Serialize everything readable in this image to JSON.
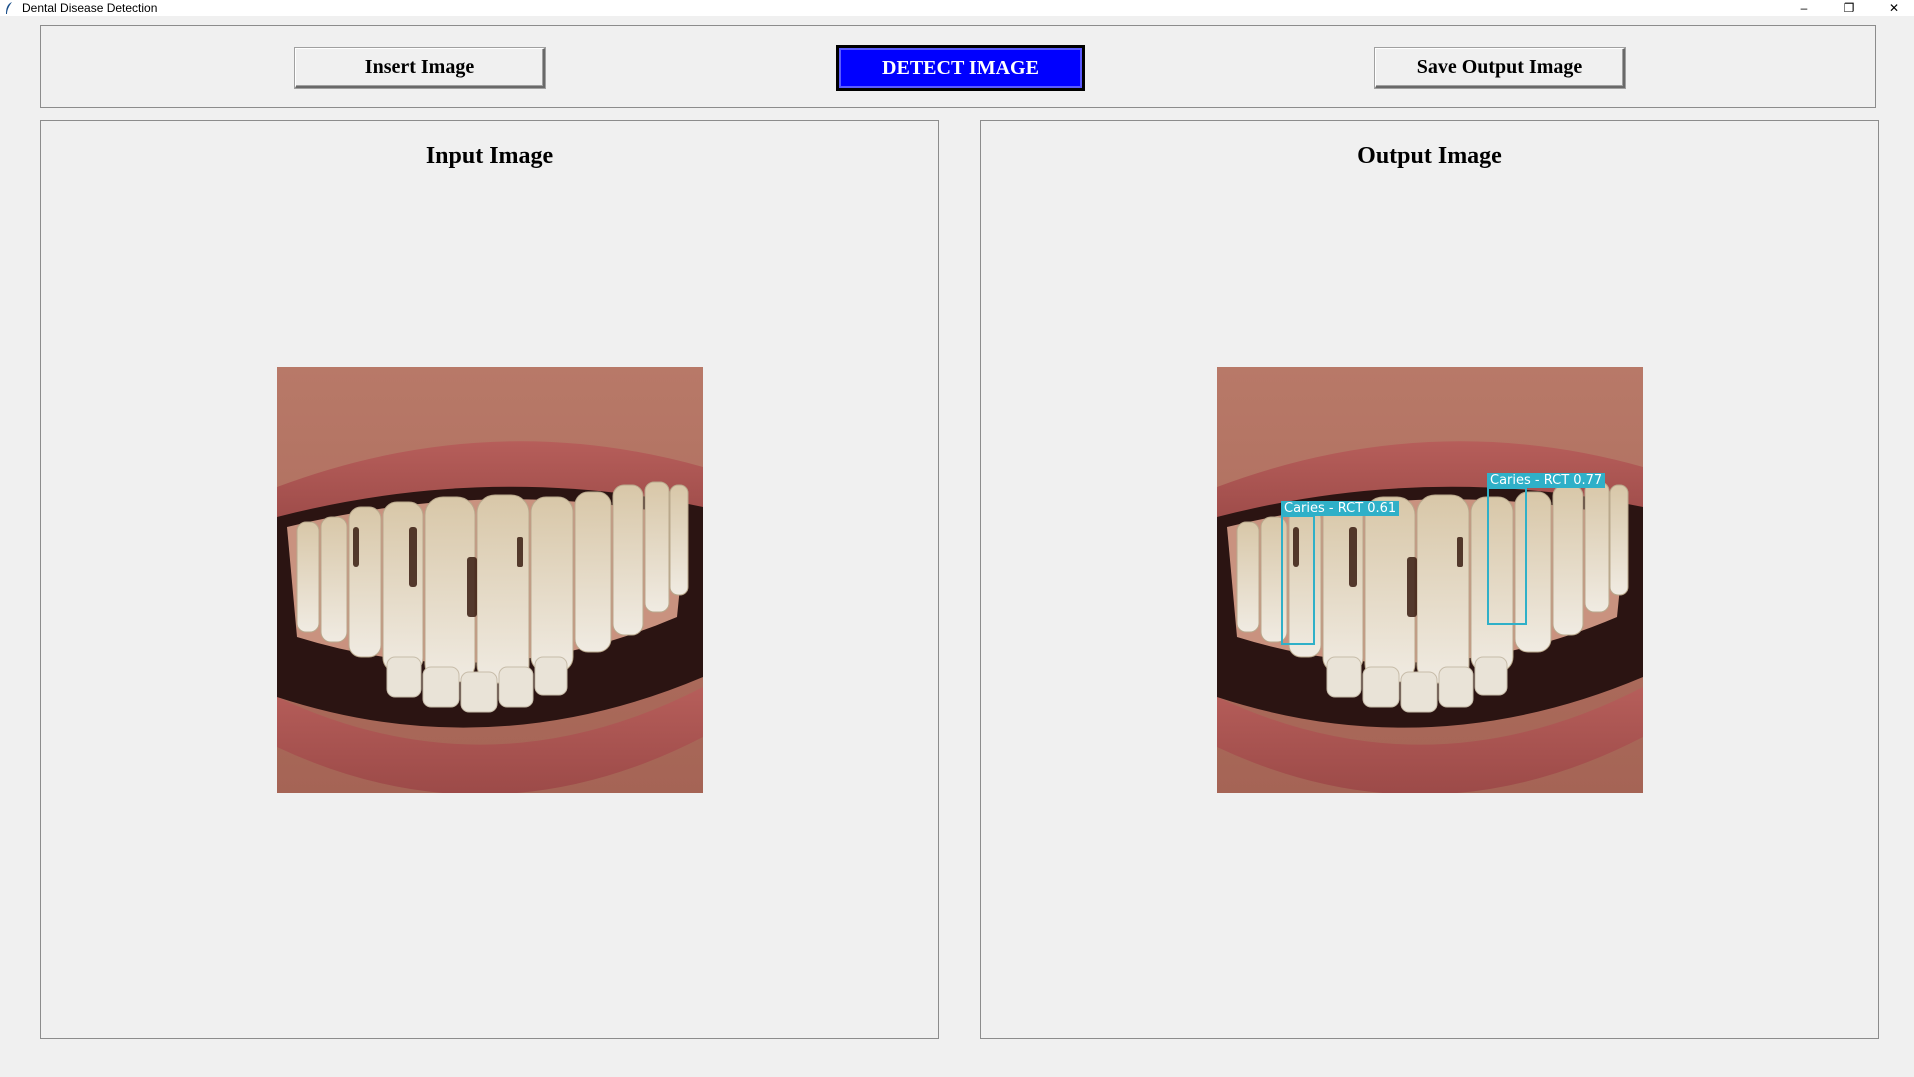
{
  "window": {
    "title": "Dental Disease Detection",
    "app_icon": "feather-icon",
    "controls": {
      "minimize_icon": "minimize-icon",
      "restore_icon": "restore-icon",
      "close_icon": "close-icon",
      "minimize_glyph": "–",
      "restore_glyph": "❐",
      "close_glyph": "✕"
    }
  },
  "toolbar": {
    "insert_label": "Insert Image",
    "detect_label": "DETECT IMAGE",
    "save_label": "Save Output Image",
    "detect_bg": "#0000ff",
    "detect_fg": "#ffffff"
  },
  "input_panel": {
    "title": "Input Image"
  },
  "output_panel": {
    "title": "Output Image",
    "detections": [
      {
        "label": "Caries - RCT 0.61"
      },
      {
        "label": "Caries - RCT 0.77"
      }
    ],
    "detection_color": "#2fb0c8"
  }
}
